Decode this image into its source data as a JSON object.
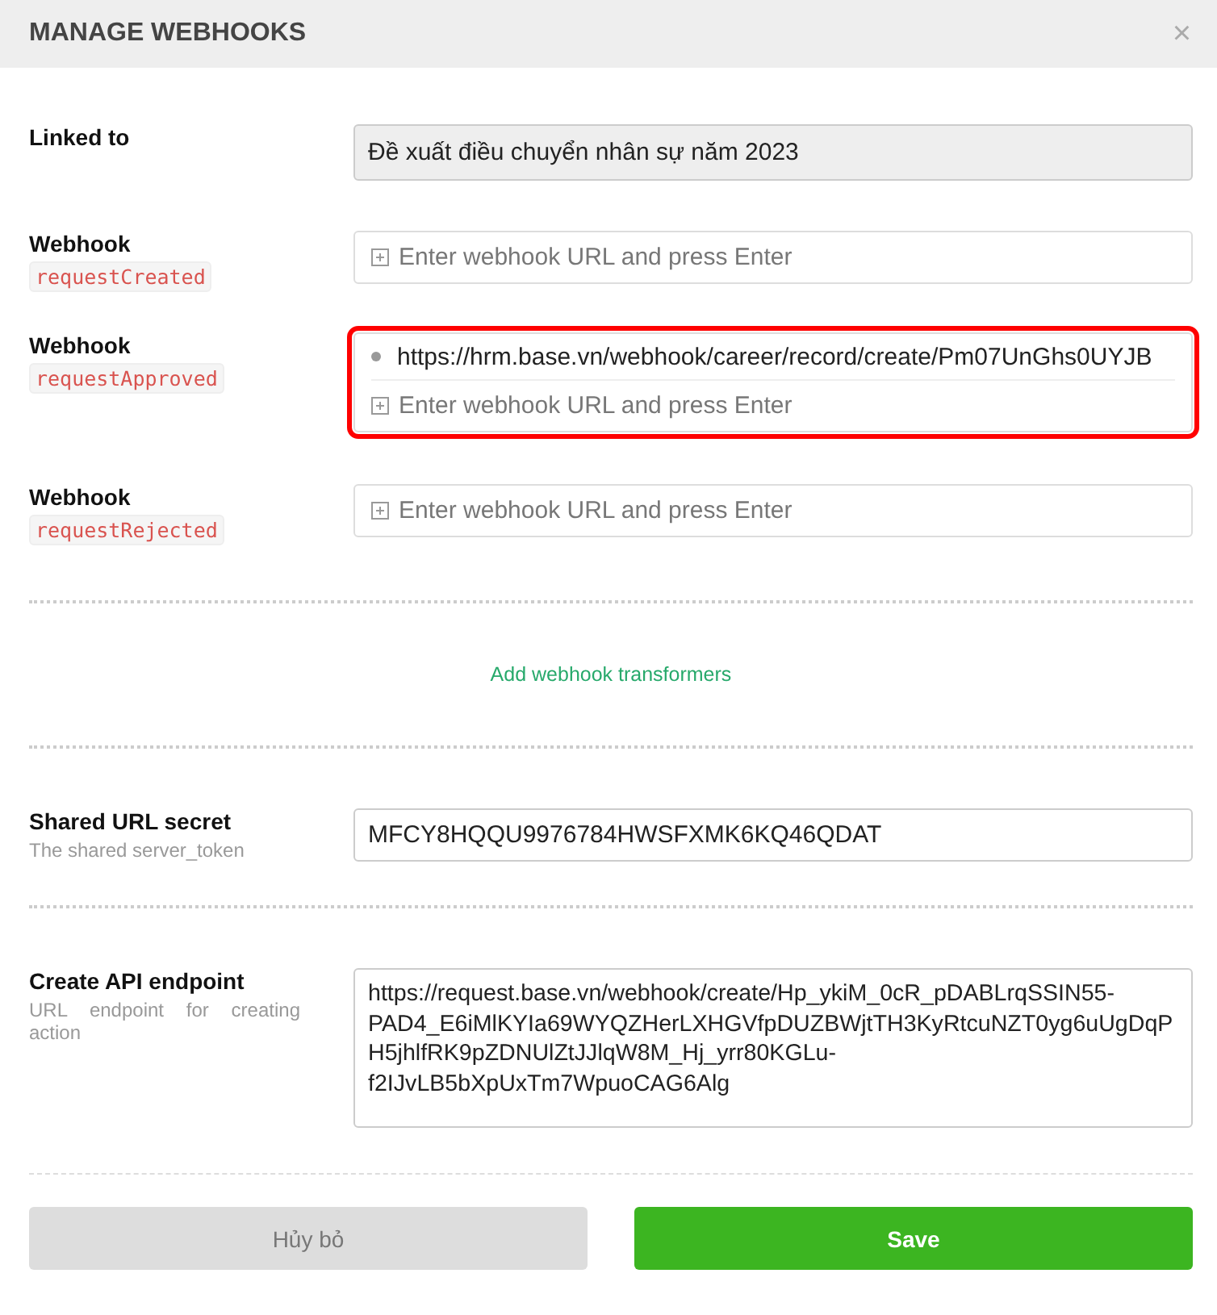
{
  "dialog": {
    "title": "MANAGE WEBHOOKS",
    "close_label": "×"
  },
  "linked_to": {
    "label": "Linked to",
    "value": "Đề xuất điều chuyển nhân sự năm 2023"
  },
  "webhooks": [
    {
      "label": "Webhook",
      "event": "requestCreated",
      "placeholder": "Enter webhook URL and press Enter",
      "highlighted": false
    },
    {
      "label": "Webhook",
      "event": "requestApproved",
      "urls": [
        "https://hrm.base.vn/webhook/career/record/create/Pm07UnGhs0UYJB"
      ],
      "placeholder": "Enter webhook URL and press Enter",
      "highlighted": true
    },
    {
      "label": "Webhook",
      "event": "requestRejected",
      "placeholder": "Enter webhook URL and press Enter",
      "highlighted": false
    }
  ],
  "transformers_link": "Add webhook transformers",
  "secret": {
    "label": "Shared URL secret",
    "hint": "The shared server_token",
    "value": "MFCY8HQQU9976784HWSFXMK6KQ46QDAT"
  },
  "endpoint": {
    "label": "Create API endpoint",
    "hint": "URL endpoint for creating action",
    "value": "https://request.base.vn/webhook/create/Hp_ykiM_0cR_pDABLrqSSIN55-PAD4_E6iMlKYIa69WYQZHerLXHGVfpDUZBWjtTH3KyRtcuNZT0yg6uUgDqPH5jhlfRK9pZDNUlZtJJlqW8M_Hj_yrr80KGLu-f2IJvLB5bXpUxTm7WpuoCAG6Alg"
  },
  "buttons": {
    "cancel": "Hủy bỏ",
    "save": "Save"
  }
}
